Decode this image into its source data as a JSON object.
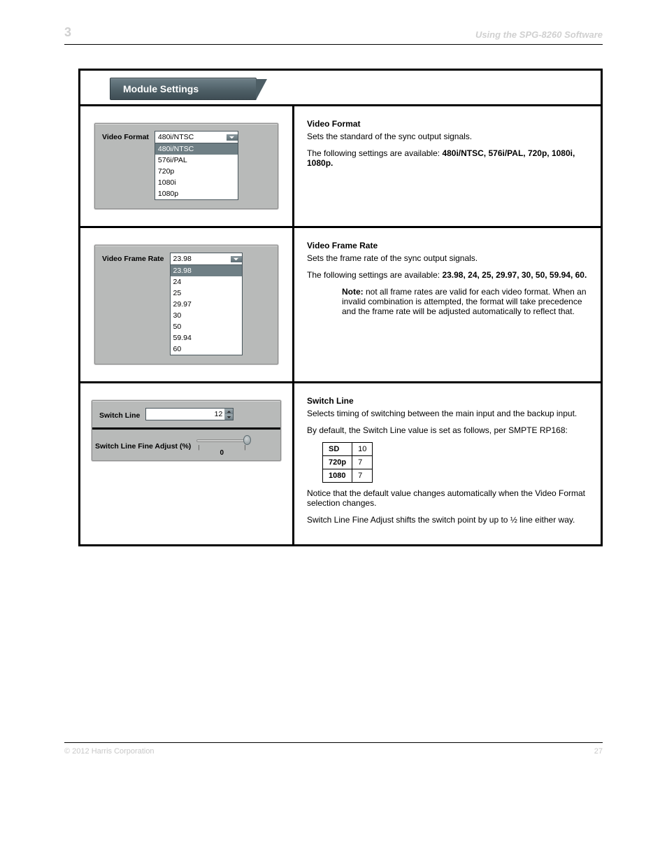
{
  "header": {
    "chapter": "3",
    "title_right": "Using the SPG-8260 Software"
  },
  "module_tab": "Module Settings",
  "rows": [
    {
      "control": {
        "label": "Video Format",
        "selected": "480i/NTSC",
        "options": [
          "480i/NTSC",
          "576i/PAL",
          "720p",
          "1080i",
          "1080p"
        ]
      },
      "desc": {
        "title": "Video Format",
        "p1": "Sets the standard of the sync output signals.",
        "p2_lead": "The following settings are available: ",
        "p2_opts": "480i/NTSC, 576i/PAL, 720p, 1080i, 1080p."
      }
    },
    {
      "control": {
        "label": "Video Frame Rate",
        "selected": "23.98",
        "options": [
          "23.98",
          "24",
          "25",
          "29.97",
          "30",
          "50",
          "59.94",
          "60"
        ]
      },
      "desc": {
        "title": "Video Frame Rate",
        "p1": "Sets the frame rate of the sync output signals.",
        "p2_lead": "The following settings are available: ",
        "p2_opts": "23.98, 24, 25, 29.97, 30, 50, 59.94, 60.",
        "note_label": "Note:",
        "note_text": " not all frame rates are valid for each video format. When an invalid combination is attempted, the format will take precedence and the frame rate will be adjusted automatically to reflect that."
      }
    },
    {
      "control_a": {
        "label": "Switch Line",
        "value": "12"
      },
      "control_b": {
        "label": "Switch Line Fine Adjust (%)",
        "value": "0"
      },
      "desc": {
        "title": "Switch Line",
        "p1": "Selects timing of switching between the main input and the backup input.",
        "p2": "By default, the Switch Line value is set as follows, per SMPTE RP168:",
        "table": [
          {
            "std": "SD",
            "val": "10"
          },
          {
            "std": "720p",
            "val": "7"
          },
          {
            "std": "1080",
            "val": "7"
          }
        ],
        "p3": "Notice that the default value changes automatically when the Video Format selection changes.",
        "p4": "Switch Line Fine Adjust shifts the switch point by up to ½ line either way."
      }
    }
  ],
  "footer": {
    "left": "© 2012 Harris Corporation",
    "right": "27"
  }
}
